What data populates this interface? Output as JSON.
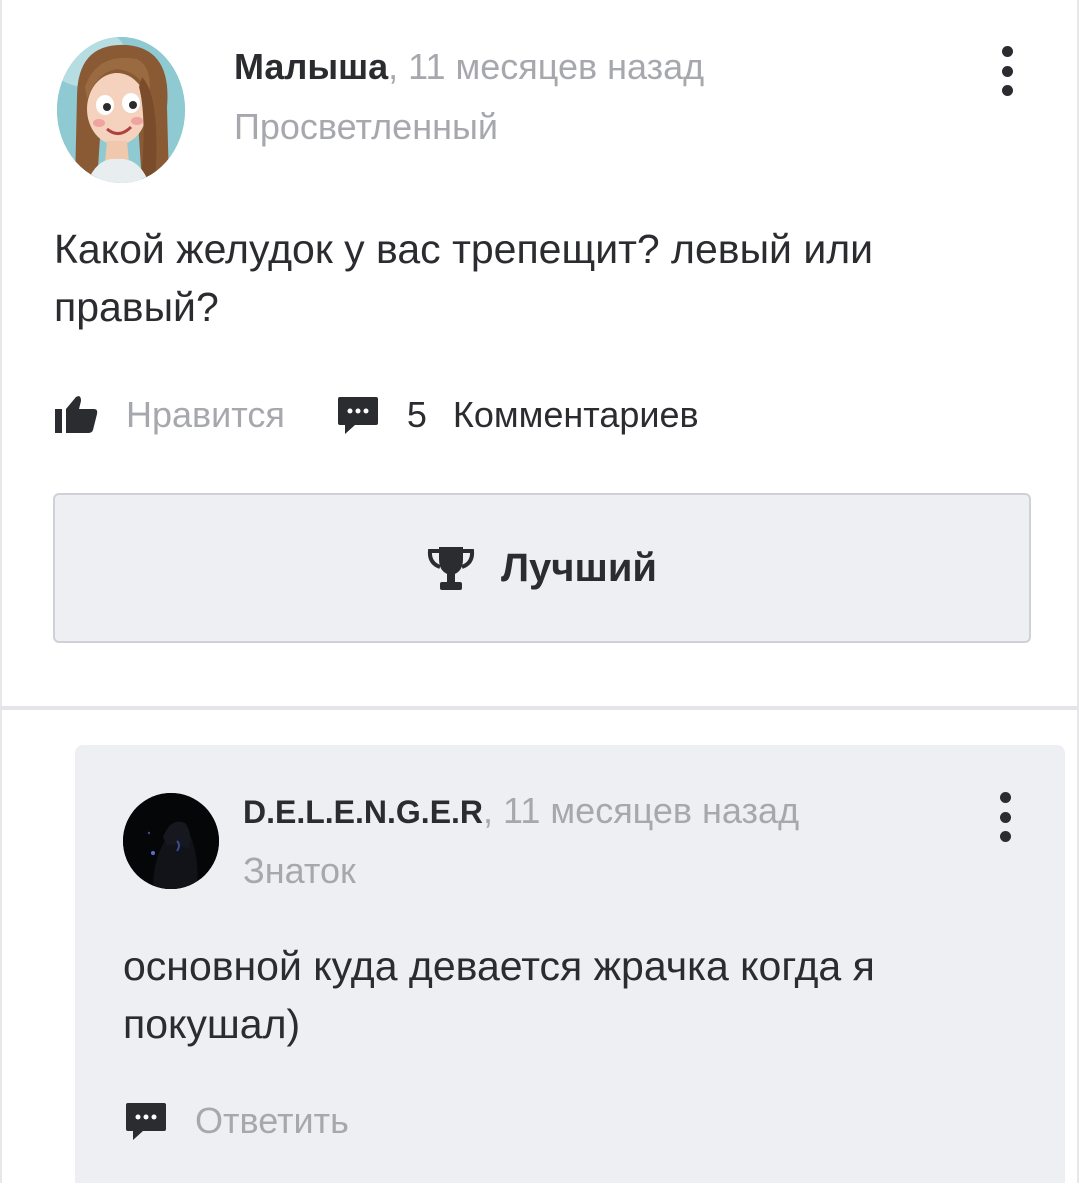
{
  "post": {
    "author": "Малыша",
    "time_sep": ", ",
    "time": "11 месяцев назад",
    "rank": "Просветленный",
    "text": "Какой желудок у вас трепещит? левый или правый?",
    "like_label": "Нравится",
    "comments_count": "5",
    "comments_label": "Комментариев",
    "best_label": "Лучший"
  },
  "reply": {
    "author": "D.E.L.E.N.G.E.R",
    "time_sep": ", ",
    "time": "11 месяцев назад",
    "rank": "Знаток",
    "text": "основной куда девается жрачка когда я покушал)",
    "reply_label": "Ответить"
  },
  "icons": {
    "like": "thumbs-up-icon",
    "comments": "comment-bubble-icon",
    "best": "trophy-icon",
    "menu": "kebab-menu-icon",
    "reply": "comment-bubble-icon"
  },
  "colors": {
    "text": "#2b2c30",
    "muted": "#a7a8ad",
    "button_bg": "#eeeff2",
    "button_border": "#cfd1d6"
  }
}
